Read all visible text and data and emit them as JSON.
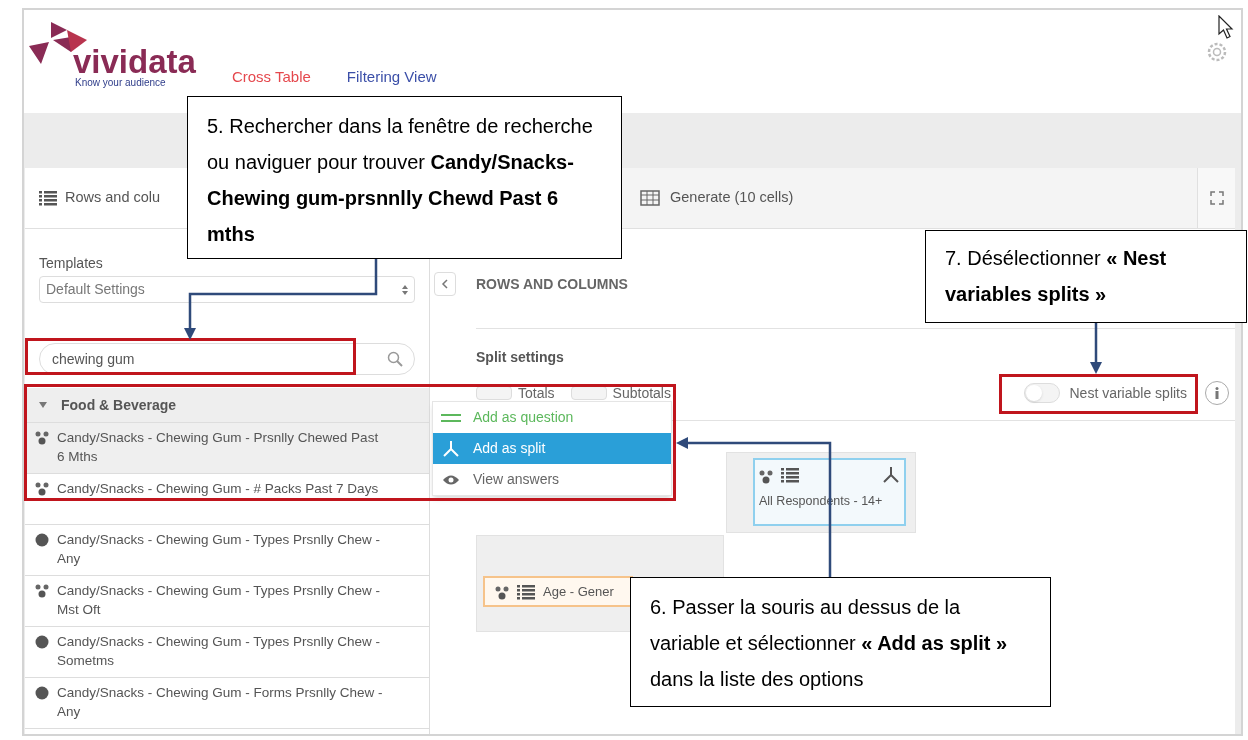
{
  "header": {
    "logo": {
      "name": "vividata",
      "tagline": "Know your audience"
    },
    "nav": [
      {
        "label": "Cross Table",
        "selected": true
      },
      {
        "label": "Filtering View",
        "selected": false
      }
    ]
  },
  "tabs": [
    {
      "label": "Rows and colu"
    },
    {
      "label": "Generate (10 cells)"
    }
  ],
  "sidebar": {
    "templates_label": "Templates",
    "template_value": "Default Settings",
    "search": {
      "value": "chewing gum"
    },
    "group": {
      "label": "Food & Beverage",
      "expanded": true
    },
    "items": [
      {
        "label": "Candy/Snacks - Chewing Gum - Prsnlly Chewed Past 6 Mths",
        "kind": "nodes",
        "selected": true
      },
      {
        "label": "Candy/Snacks - Chewing Gum - # Packs Past 7 Days",
        "kind": "nodes",
        "selected": false
      },
      {
        "label": "Candy/Snacks - Chewing Gum - Types Prsnlly Chew - Any",
        "kind": "round",
        "selected": false
      },
      {
        "label": "Candy/Snacks - Chewing Gum - Types Prsnlly Chew - Mst Oft",
        "kind": "nodes",
        "selected": false
      },
      {
        "label": "Candy/Snacks - Chewing Gum - Types Prsnlly Chew - Sometms",
        "kind": "round",
        "selected": false
      },
      {
        "label": "Candy/Snacks - Chewing Gum - Forms Prsnlly Chew - Any",
        "kind": "round",
        "selected": false
      }
    ]
  },
  "context_menu": [
    {
      "label": "Add as question",
      "kind": "question",
      "selected": false
    },
    {
      "label": "Add as split",
      "kind": "split",
      "selected": true
    },
    {
      "label": "View answers",
      "kind": "answers",
      "selected": false
    }
  ],
  "main": {
    "title": "ROWS AND COLUMNS",
    "split_settings": "Split settings",
    "options": [
      {
        "label": "Totals",
        "checked": false
      },
      {
        "label": "Subtotals",
        "checked": false
      }
    ],
    "nest_toggle": {
      "label": "Nest variable splits",
      "on": false
    },
    "column_card": "All Respondents - 14+",
    "row_card": "Age - Gener"
  },
  "callouts": [
    {
      "text": "5. Rechercher dans la fenêtre de recherche ou naviguer pour trouver **Candy/Snacks-Chewing gum-prsnnlly Chewd Past 6 mths**"
    },
    {
      "text": "7. Désélectionner **« Nest variables splits »**"
    },
    {
      "text": "6. Passer la souris au dessus de la variable et sélectionner **« Add as split »** dans la liste des options"
    }
  ]
}
